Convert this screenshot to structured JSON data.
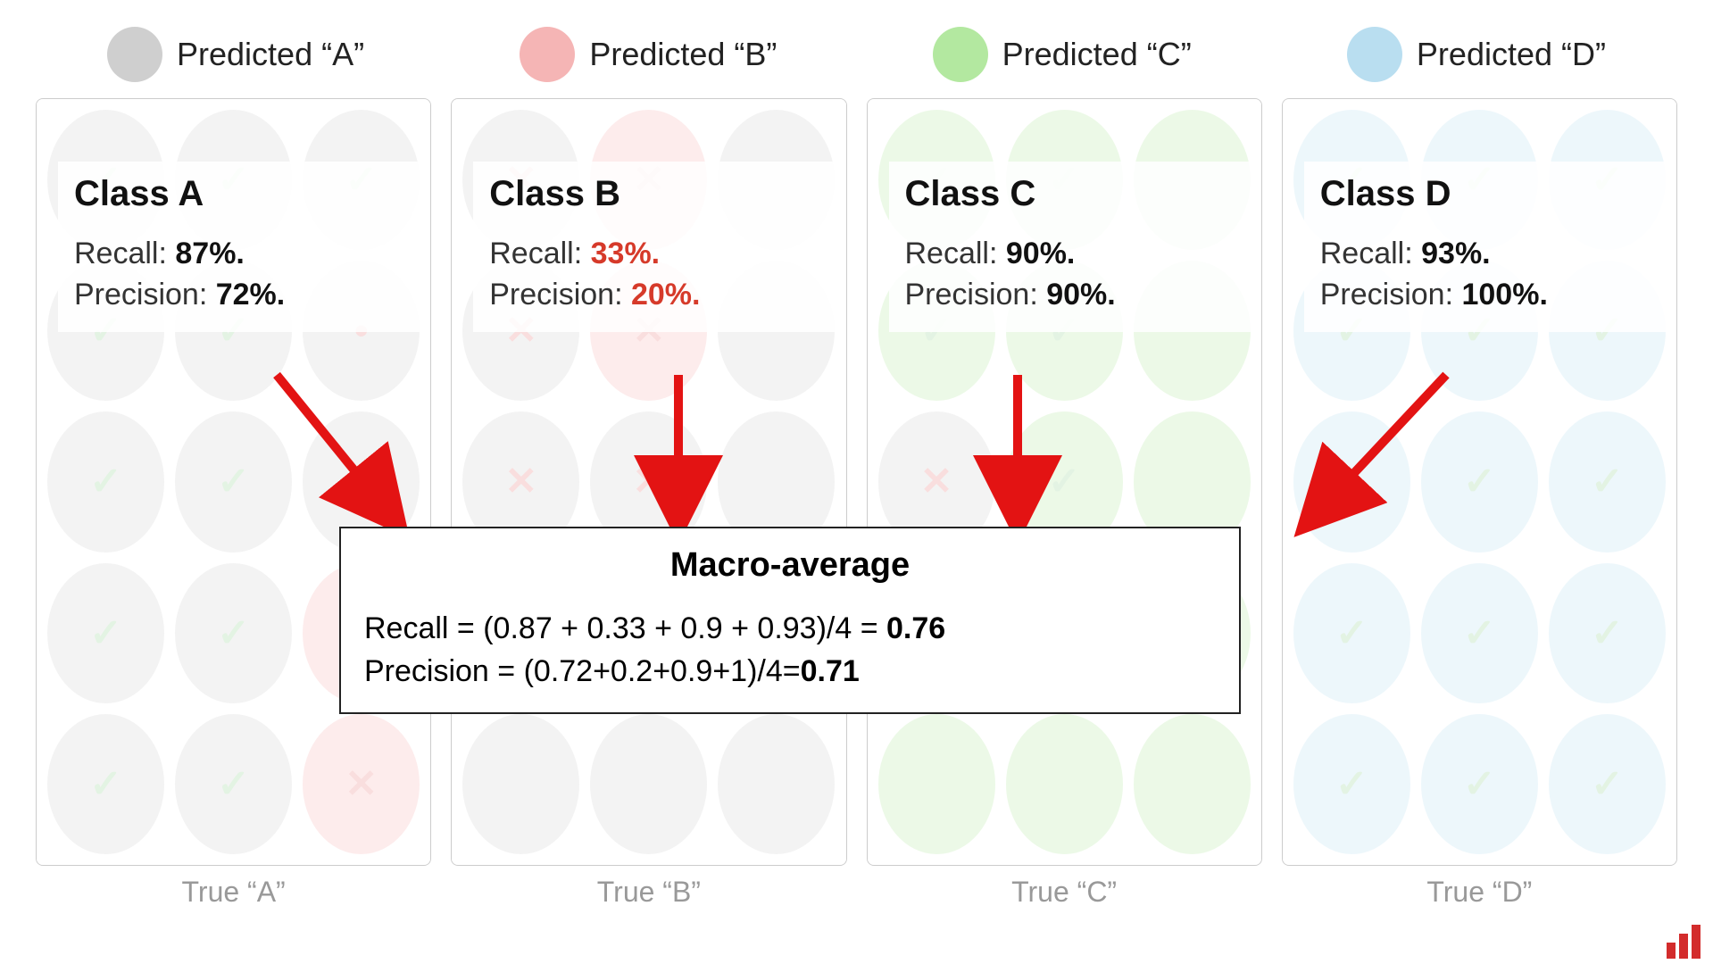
{
  "legend": [
    {
      "label": "Predicted “A”",
      "color": "#cfcfcf"
    },
    {
      "label": "Predicted “B”",
      "color": "#f5b5b5"
    },
    {
      "label": "Predicted “C”",
      "color": "#b3e8a0"
    },
    {
      "label": "Predicted “D”",
      "color": "#b9def0"
    }
  ],
  "classes": [
    {
      "title": "Class A",
      "true_label": "True “A”",
      "recall_label": "Recall: ",
      "recall_value": "87%.",
      "precision_label": "Precision: ",
      "precision_value": "72%.",
      "value_color": "#111",
      "dots": [
        {
          "c": "#cfcfcf",
          "m": "check"
        },
        {
          "c": "#cfcfcf",
          "m": "check"
        },
        {
          "c": "#cfcfcf",
          "m": "check"
        },
        {
          "c": "#cfcfcf",
          "m": "check"
        },
        {
          "c": "#cfcfcf",
          "m": "check"
        },
        {
          "c": "#cfcfcf",
          "m": "dot"
        },
        {
          "c": "#cfcfcf",
          "m": "check"
        },
        {
          "c": "#cfcfcf",
          "m": "check"
        },
        {
          "c": "#cfcfcf",
          "m": "check"
        },
        {
          "c": "#cfcfcf",
          "m": "check"
        },
        {
          "c": "#cfcfcf",
          "m": "check"
        },
        {
          "c": "#f5b5b5",
          "m": "x"
        },
        {
          "c": "#cfcfcf",
          "m": "check"
        },
        {
          "c": "#cfcfcf",
          "m": "check"
        },
        {
          "c": "#f5b5b5",
          "m": "x"
        }
      ]
    },
    {
      "title": "Class B",
      "true_label": "True “B”",
      "recall_label": "Recall: ",
      "recall_value": "33%.",
      "precision_label": "Precision: ",
      "precision_value": "20%.",
      "value_color": "#d63a2a",
      "dots": [
        {
          "c": "#cfcfcf",
          "m": "x"
        },
        {
          "c": "#f5b5b5",
          "m": "x"
        },
        {
          "c": "#cfcfcf",
          "m": ""
        },
        {
          "c": "#cfcfcf",
          "m": "x"
        },
        {
          "c": "#f5b5b5",
          "m": "x"
        },
        {
          "c": "#cfcfcf",
          "m": ""
        },
        {
          "c": "#cfcfcf",
          "m": "x"
        },
        {
          "c": "#cfcfcf",
          "m": "x"
        },
        {
          "c": "#cfcfcf",
          "m": ""
        },
        {
          "c": "#cfcfcf",
          "m": ""
        },
        {
          "c": "#cfcfcf",
          "m": "x"
        },
        {
          "c": "#cfcfcf",
          "m": ""
        },
        {
          "c": "#cfcfcf",
          "m": ""
        },
        {
          "c": "#cfcfcf",
          "m": ""
        },
        {
          "c": "#cfcfcf",
          "m": ""
        }
      ]
    },
    {
      "title": "Class C",
      "true_label": "True “C”",
      "recall_label": "Recall: ",
      "recall_value": "90%.",
      "precision_label": "Precision: ",
      "precision_value": "90%.",
      "value_color": "#111",
      "dots": [
        {
          "c": "#b3e8a0",
          "m": "check"
        },
        {
          "c": "#b3e8a0",
          "m": "check"
        },
        {
          "c": "#b3e8a0",
          "m": ""
        },
        {
          "c": "#b3e8a0",
          "m": "check"
        },
        {
          "c": "#b3e8a0",
          "m": "check"
        },
        {
          "c": "#b3e8a0",
          "m": ""
        },
        {
          "c": "#cfcfcf",
          "m": "x"
        },
        {
          "c": "#b3e8a0",
          "m": "check"
        },
        {
          "c": "#b3e8a0",
          "m": ""
        },
        {
          "c": "#b3e8a0",
          "m": "check"
        },
        {
          "c": "#b3e8a0",
          "m": "check"
        },
        {
          "c": "#b3e8a0",
          "m": ""
        },
        {
          "c": "#b3e8a0",
          "m": ""
        },
        {
          "c": "#b3e8a0",
          "m": ""
        },
        {
          "c": "#b3e8a0",
          "m": ""
        }
      ]
    },
    {
      "title": "Class D",
      "true_label": "True “D”",
      "recall_label": "Recall: ",
      "recall_value": "93%.",
      "precision_label": "Precision: ",
      "precision_value": "100%.",
      "value_color": "#111",
      "dots": [
        {
          "c": "#b9def0",
          "m": "check"
        },
        {
          "c": "#b9def0",
          "m": "check"
        },
        {
          "c": "#b9def0",
          "m": "check"
        },
        {
          "c": "#b9def0",
          "m": "check"
        },
        {
          "c": "#b9def0",
          "m": "check"
        },
        {
          "c": "#b9def0",
          "m": "check"
        },
        {
          "c": "#b9def0",
          "m": "check"
        },
        {
          "c": "#b9def0",
          "m": "check"
        },
        {
          "c": "#b9def0",
          "m": "check"
        },
        {
          "c": "#b9def0",
          "m": "check"
        },
        {
          "c": "#b9def0",
          "m": "check"
        },
        {
          "c": "#b9def0",
          "m": "check"
        },
        {
          "c": "#b9def0",
          "m": "check"
        },
        {
          "c": "#b9def0",
          "m": "check"
        },
        {
          "c": "#b9def0",
          "m": "check"
        }
      ]
    }
  ],
  "macro": {
    "title": "Macro-average",
    "recall_line_prefix": "Recall = (0.87 + 0.33 + 0.9 + 0.93)/4 = ",
    "recall_result": "0.76",
    "precision_line_prefix": "Precision = (0.72+0.2+0.9+1)/4=",
    "precision_result": "0.71"
  },
  "chart_data": {
    "type": "table",
    "title": "Per-class precision/recall and macro-average",
    "rows": [
      {
        "class": "A",
        "recall": 0.87,
        "precision": 0.72
      },
      {
        "class": "B",
        "recall": 0.33,
        "precision": 0.2
      },
      {
        "class": "C",
        "recall": 0.9,
        "precision": 0.9
      },
      {
        "class": "D",
        "recall": 0.93,
        "precision": 1.0
      }
    ],
    "macro_average": {
      "recall": 0.76,
      "precision": 0.71
    }
  }
}
